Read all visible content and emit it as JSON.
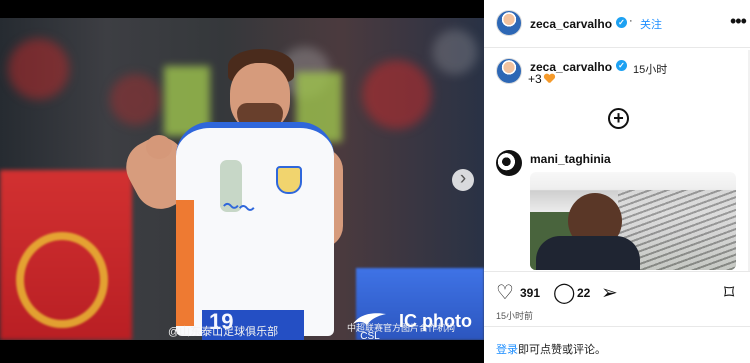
{
  "post": {
    "username": "zeca_carvalho",
    "follow_label": "关注",
    "dot_separator": "·",
    "more_icon": "more-options-icon",
    "time_ago": "15小时",
    "caption": "+3"
  },
  "photo": {
    "caption": "@山东泰山足球俱乐部",
    "credit": "photo",
    "credit_cn": "中超联赛官方图片合作机构",
    "csl_logo": "CSL",
    "shirt_number": "19"
  },
  "comment": {
    "username": "mani_taghinia"
  },
  "actions": {
    "like_count": "391",
    "comment_count": "22",
    "timestamp": "15小时前",
    "login_text": "登录",
    "login_suffix": "即可点赞或评论。"
  },
  "colors": {
    "link_blue": "#1f8fff",
    "verified_blue": "#1da1f2",
    "heart_orange": "#f59a2b"
  }
}
